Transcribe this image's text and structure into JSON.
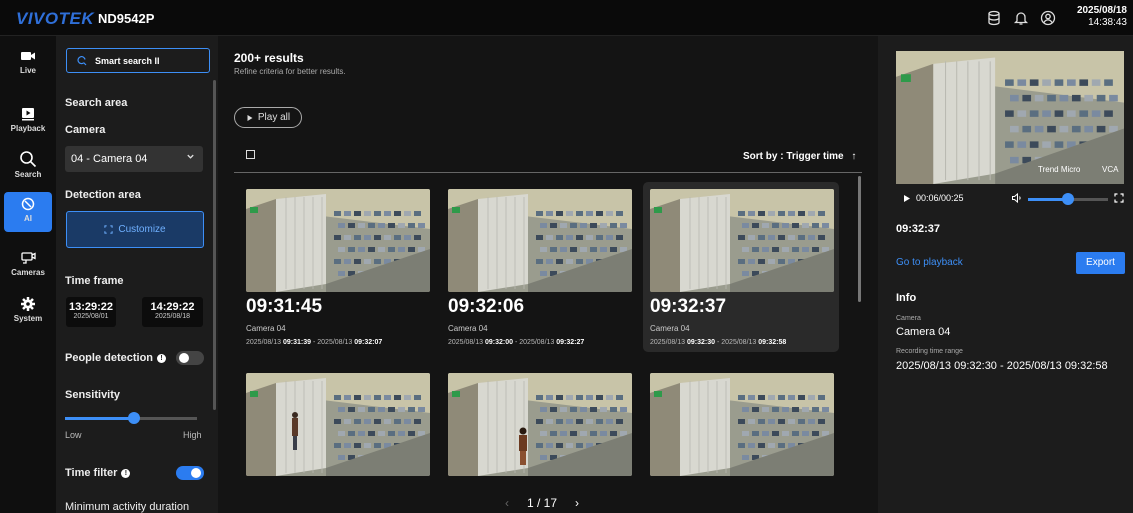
{
  "topbar": {
    "logo": "VIVOTEK",
    "model": "ND9542P",
    "date": "2025/08/18",
    "time": "14:38:43"
  },
  "nav": {
    "items": [
      {
        "label": "Live"
      },
      {
        "label": "Playback"
      },
      {
        "label": "Search"
      },
      {
        "label": "AI"
      },
      {
        "label": "Cameras"
      },
      {
        "label": "System"
      }
    ]
  },
  "filters": {
    "smart_search": "Smart search II",
    "search_area": "Search area",
    "camera_label": "Camera",
    "camera_value": "04 - Camera 04",
    "detection_area": "Detection area",
    "customize": "Customize",
    "time_frame": "Time frame",
    "start_time": "13:29:22",
    "start_date": "2025/08/01",
    "end_time": "14:29:22",
    "end_date": "2025/08/18",
    "dash": "-",
    "people_detection": "People detection",
    "sensitivity": "Sensitivity",
    "low": "Low",
    "high": "High",
    "time_filter": "Time filter",
    "min_activity": "Minimum activity duration",
    "sensitivity_level": 0.52,
    "info_glyph": "!"
  },
  "results": {
    "count": "200+ results",
    "hint": "Refine criteria for better results.",
    "play_all": "Play all",
    "sort_by": "Sort by : Trigger time",
    "sort_arrow": "↑",
    "cards": [
      {
        "time": "09:31:45",
        "camera": "Camera 04",
        "d1": "2025/08/13",
        "t1": "09:31:39",
        "d2": "2025/08/13",
        "t2": "09:32:07"
      },
      {
        "time": "09:32:06",
        "camera": "Camera 04",
        "d1": "2025/08/13",
        "t1": "09:32:00",
        "d2": "2025/08/13",
        "t2": "09:32:27"
      },
      {
        "time": "09:32:37",
        "camera": "Camera 04",
        "d1": "2025/08/13",
        "t1": "09:32:30",
        "d2": "2025/08/13",
        "t2": "09:32:58"
      }
    ],
    "pager": {
      "prev": "‹",
      "page": "1 / 17",
      "next": "›"
    }
  },
  "detail": {
    "overlay_left": "Trend Micro",
    "overlay_right": "VCA",
    "progress": "00:06/00:25",
    "trigger_time": "09:32:37",
    "goto": "Go to playback",
    "export": "Export",
    "info": "Info",
    "camera_key": "Camera",
    "camera_value": "Camera 04",
    "range_key": "Recording time range",
    "range_value": "2025/08/13 09:32:30 - 2025/08/13 09:32:58",
    "volume_level": 0.5
  }
}
